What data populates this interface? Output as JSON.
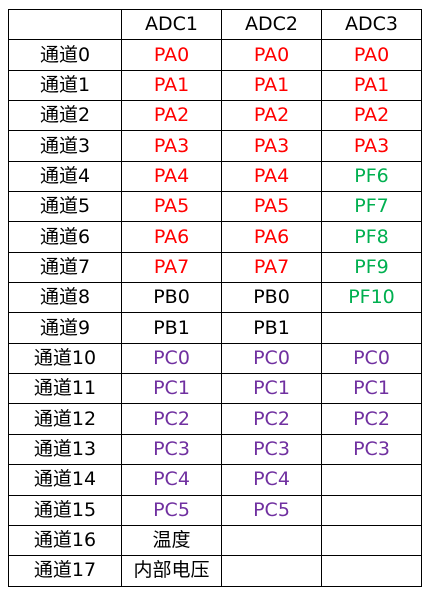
{
  "colors": {
    "red": "#ff0000",
    "purple": "#7030a0",
    "green": "#00b050",
    "black": "#000000"
  },
  "header": [
    "",
    "ADC1",
    "ADC2",
    "ADC3"
  ],
  "rows": [
    {
      "channel": "通道0",
      "cells": [
        {
          "text": "PA0",
          "color": "red"
        },
        {
          "text": "PA0",
          "color": "red"
        },
        {
          "text": "PA0",
          "color": "red"
        }
      ]
    },
    {
      "channel": "通道1",
      "cells": [
        {
          "text": "PA1",
          "color": "red"
        },
        {
          "text": "PA1",
          "color": "red"
        },
        {
          "text": "PA1",
          "color": "red"
        }
      ]
    },
    {
      "channel": "通道2",
      "cells": [
        {
          "text": "PA2",
          "color": "red"
        },
        {
          "text": "PA2",
          "color": "red"
        },
        {
          "text": "PA2",
          "color": "red"
        }
      ]
    },
    {
      "channel": "通道3",
      "cells": [
        {
          "text": "PA3",
          "color": "red"
        },
        {
          "text": "PA3",
          "color": "red"
        },
        {
          "text": "PA3",
          "color": "red"
        }
      ]
    },
    {
      "channel": "通道4",
      "cells": [
        {
          "text": "PA4",
          "color": "red"
        },
        {
          "text": "PA4",
          "color": "red"
        },
        {
          "text": "PF6",
          "color": "green"
        }
      ]
    },
    {
      "channel": "通道5",
      "cells": [
        {
          "text": "PA5",
          "color": "red"
        },
        {
          "text": "PA5",
          "color": "red"
        },
        {
          "text": "PF7",
          "color": "green"
        }
      ]
    },
    {
      "channel": "通道6",
      "cells": [
        {
          "text": "PA6",
          "color": "red"
        },
        {
          "text": "PA6",
          "color": "red"
        },
        {
          "text": "PF8",
          "color": "green"
        }
      ]
    },
    {
      "channel": "通道7",
      "cells": [
        {
          "text": "PA7",
          "color": "red"
        },
        {
          "text": "PA7",
          "color": "red"
        },
        {
          "text": "PF9",
          "color": "green"
        }
      ]
    },
    {
      "channel": "通道8",
      "cells": [
        {
          "text": "PB0",
          "color": "black"
        },
        {
          "text": "PB0",
          "color": "black"
        },
        {
          "text": "PF10",
          "color": "green"
        }
      ]
    },
    {
      "channel": "通道9",
      "cells": [
        {
          "text": "PB1",
          "color": "black"
        },
        {
          "text": "PB1",
          "color": "black"
        },
        {
          "text": "",
          "color": "black"
        }
      ]
    },
    {
      "channel": "通道10",
      "cells": [
        {
          "text": "PC0",
          "color": "purple"
        },
        {
          "text": "PC0",
          "color": "purple"
        },
        {
          "text": "PC0",
          "color": "purple"
        }
      ]
    },
    {
      "channel": "通道11",
      "cells": [
        {
          "text": "PC1",
          "color": "purple"
        },
        {
          "text": "PC1",
          "color": "purple"
        },
        {
          "text": "PC1",
          "color": "purple"
        }
      ]
    },
    {
      "channel": "通道12",
      "cells": [
        {
          "text": "PC2",
          "color": "purple"
        },
        {
          "text": "PC2",
          "color": "purple"
        },
        {
          "text": "PC2",
          "color": "purple"
        }
      ]
    },
    {
      "channel": "通道13",
      "cells": [
        {
          "text": "PC3",
          "color": "purple"
        },
        {
          "text": "PC3",
          "color": "purple"
        },
        {
          "text": "PC3",
          "color": "purple"
        }
      ]
    },
    {
      "channel": "通道14",
      "cells": [
        {
          "text": "PC4",
          "color": "purple"
        },
        {
          "text": "PC4",
          "color": "purple"
        },
        {
          "text": "",
          "color": "black"
        }
      ]
    },
    {
      "channel": "通道15",
      "cells": [
        {
          "text": "PC5",
          "color": "purple"
        },
        {
          "text": "PC5",
          "color": "purple"
        },
        {
          "text": "",
          "color": "black"
        }
      ]
    },
    {
      "channel": "通道16",
      "cells": [
        {
          "text": "温度",
          "color": "black"
        },
        {
          "text": "",
          "color": "black"
        },
        {
          "text": "",
          "color": "black"
        }
      ]
    },
    {
      "channel": "通道17",
      "cells": [
        {
          "text": "内部电压",
          "color": "black"
        },
        {
          "text": "",
          "color": "black"
        },
        {
          "text": "",
          "color": "black"
        }
      ]
    }
  ]
}
